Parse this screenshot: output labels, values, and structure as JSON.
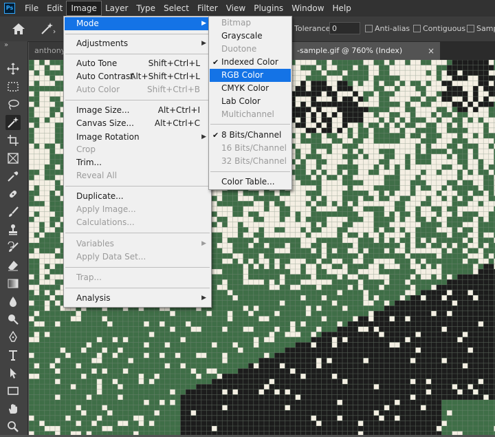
{
  "app": {
    "logo_text": "Ps"
  },
  "menubar": {
    "items": [
      "File",
      "Edit",
      "Image",
      "Layer",
      "Type",
      "Select",
      "Filter",
      "View",
      "Plugins",
      "Window",
      "Help"
    ],
    "active": "Image"
  },
  "options": {
    "tolerance_label": "Tolerance:",
    "tolerance_value": "0",
    "anti_alias_label": "Anti-alias",
    "contiguous_label": "Contiguous",
    "sample_label": "Sampl"
  },
  "tabs": {
    "inactive_label": "anthony",
    "active_label": "-sample.gif @ 760% (Index)",
    "close_glyph": "×"
  },
  "image_menu": {
    "items": [
      {
        "label": "Mode",
        "has_submenu": true,
        "highlighted": true
      },
      {
        "label": "Adjustments",
        "has_submenu": true
      },
      {
        "label": "Auto Tone",
        "shortcut": "Shift+Ctrl+L"
      },
      {
        "label": "Auto Contrast",
        "shortcut": "Alt+Shift+Ctrl+L"
      },
      {
        "label": "Auto Color",
        "shortcut": "Shift+Ctrl+B",
        "disabled": true
      },
      {
        "label": "Image Size...",
        "shortcut": "Alt+Ctrl+I"
      },
      {
        "label": "Canvas Size...",
        "shortcut": "Alt+Ctrl+C"
      },
      {
        "label": "Image Rotation",
        "has_submenu": true
      },
      {
        "label": "Crop",
        "disabled": true
      },
      {
        "label": "Trim..."
      },
      {
        "label": "Reveal All",
        "disabled": true
      },
      {
        "label": "Duplicate..."
      },
      {
        "label": "Apply Image...",
        "disabled": true
      },
      {
        "label": "Calculations...",
        "disabled": true
      },
      {
        "label": "Variables",
        "has_submenu": true,
        "disabled": true
      },
      {
        "label": "Apply Data Set...",
        "disabled": true
      },
      {
        "label": "Trap...",
        "disabled": true
      },
      {
        "label": "Analysis",
        "has_submenu": true
      }
    ]
  },
  "mode_submenu": {
    "items": [
      {
        "label": "Bitmap",
        "disabled": true
      },
      {
        "label": "Grayscale"
      },
      {
        "label": "Duotone",
        "disabled": true
      },
      {
        "label": "Indexed Color",
        "checked": true
      },
      {
        "label": "RGB Color",
        "highlighted": true
      },
      {
        "label": "CMYK Color"
      },
      {
        "label": "Lab Color"
      },
      {
        "label": "Multichannel",
        "disabled": true
      },
      {
        "label": "8 Bits/Channel",
        "checked": true
      },
      {
        "label": "16 Bits/Channel",
        "disabled": true
      },
      {
        "label": "32 Bits/Channel",
        "disabled": true
      },
      {
        "label": "Color Table..."
      }
    ],
    "check_glyph": "✔"
  },
  "toolbar": {
    "collapse_glyph": "»",
    "tools": [
      "move-icon",
      "marquee-icon",
      "lasso-icon",
      "magic-wand-icon",
      "crop-icon",
      "frame-icon",
      "eyedropper-icon",
      "healing-brush-icon",
      "brush-icon",
      "clone-stamp-icon",
      "history-brush-icon",
      "eraser-icon",
      "gradient-icon",
      "blur-icon",
      "dodge-icon",
      "pen-icon",
      "type-icon",
      "path-selection-icon",
      "rectangle-icon",
      "hand-icon",
      "zoom-icon"
    ],
    "selected": "magic-wand-icon"
  },
  "colors": {
    "cream": "#f4efe3",
    "green": "#3f6e47",
    "dark": "#1c1c1c",
    "highlight": "#1473e6"
  }
}
